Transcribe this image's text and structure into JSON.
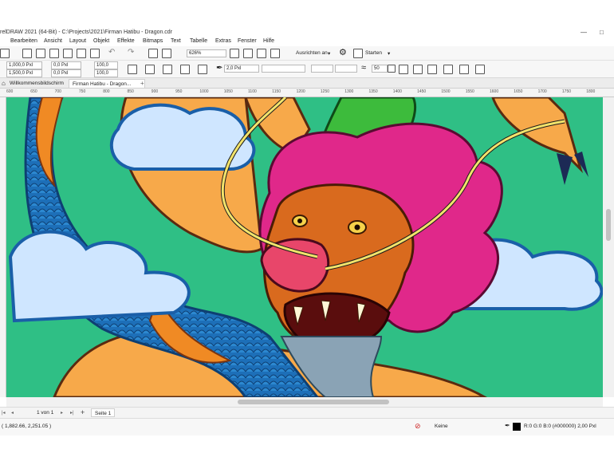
{
  "window": {
    "title": "relDRAW 2021 (64-Bit) - C:\\Projects\\2021\\Firman Hatibu - Dragon.cdr",
    "controls": [
      "—",
      "□"
    ]
  },
  "menu": [
    "Bearbeiten",
    "Ansicht",
    "Layout",
    "Objekt",
    "Effekte",
    "Bitmaps",
    "Text",
    "Tabelle",
    "Extras",
    "Fenster",
    "Hilfe"
  ],
  "standard_toolbar": {
    "zoom": "626%",
    "snap_label": "Ausrichten an",
    "launch_label": "Starten"
  },
  "property_bar": {
    "width": "1,000,0 Pxl",
    "height": "1,500,0 Pxl",
    "pos_x": "0,0 Pxl",
    "pos_y": "0,0 Pxl",
    "scale_x": "100,0",
    "scale_y": "100,0",
    "outline_width": "2,0 Pxl",
    "smoothing": "50"
  },
  "tabs": [
    {
      "label": "Willkommensbildschirm"
    },
    {
      "label": "Firman Hatibu - Dragon..."
    }
  ],
  "ruler_ticks": [
    "600",
    "650",
    "700",
    "750",
    "800",
    "850",
    "900",
    "950",
    "1000",
    "1050",
    "1100",
    "1150",
    "1200",
    "1250",
    "1300",
    "1350",
    "1400",
    "1450",
    "1500",
    "1550",
    "1600",
    "1650",
    "1700",
    "1750",
    "1800"
  ],
  "page_nav": {
    "counter": "1  von 1",
    "page_tab": "Seite 1"
  },
  "status": {
    "coordinates": "( 1,882.66, 2,251.05 )",
    "fill_label": "Keine",
    "outline_info": "R:0 G:0 B:0 (#000000)  2,00 Pxl"
  },
  "colors": {
    "canvas_green": "#2fbf85",
    "dragon_scales_blue": "#1d6fb8",
    "dragon_belly_orange": "#f7a94a",
    "dragon_mane_magenta": "#e0288a",
    "dragon_horn_green": "#3dbb3c",
    "cloud_light_blue": "#cfe6ff",
    "whisker_yellow": "#f2e36b"
  },
  "icons": [
    "new-document-icon",
    "open-icon",
    "save-icon",
    "print-icon",
    "undo-icon",
    "redo-icon",
    "import-icon",
    "export-icon",
    "full-screen-icon",
    "rulers-icon",
    "grid-icon",
    "guidelines-icon",
    "settings-gear-icon",
    "launch-icon",
    "pen-icon",
    "arrowhead-icon",
    "welcome-icon",
    "new-tab-icon",
    "fill-none-icon",
    "outline-color-icon"
  ]
}
